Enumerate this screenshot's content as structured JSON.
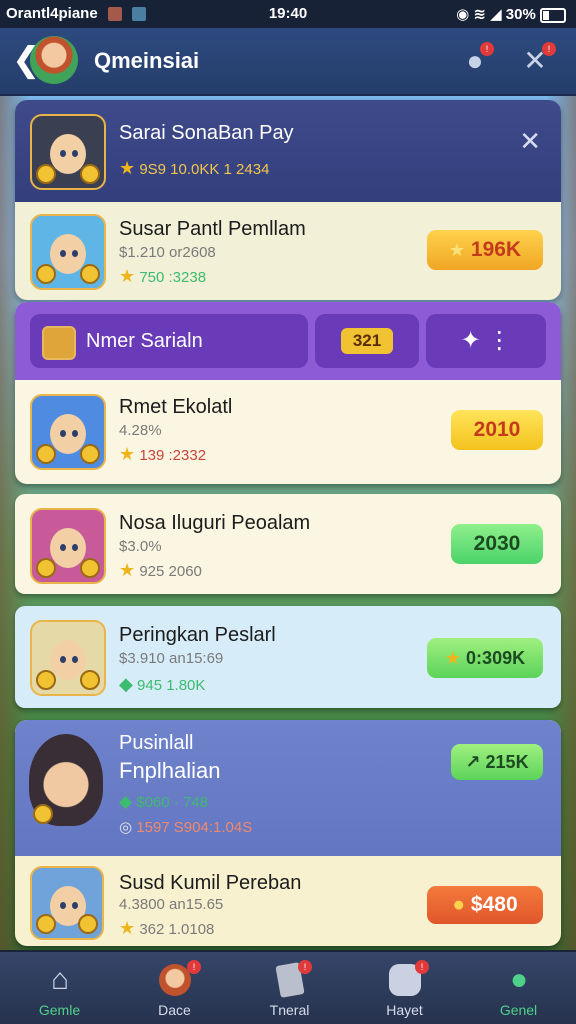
{
  "status_bar": {
    "left_text": "Orantl4piane",
    "time": "19:40",
    "battery": "30%"
  },
  "header": {
    "title": "Qmeinsiai"
  },
  "top_card": {
    "title": "Sarai SonaBan Pay",
    "stats": "9S9  10.0KK 1 2434",
    "close_label": "✕"
  },
  "row1": {
    "name": "Susar Pantl Pemllam",
    "sub": "$1.210   or2608",
    "stat": "750  :3238",
    "value": "196K"
  },
  "filter": {
    "label": "Nmer Sarialn",
    "chip": "321"
  },
  "rows": [
    {
      "name": "Rmet Ekolatl",
      "sub": "4.28%",
      "stat": "139  :2332",
      "value": "2010"
    },
    {
      "name": "Nosa Iluguri Peoalam",
      "sub": "$3.0%",
      "stat": "925   2060",
      "value": "2030"
    },
    {
      "name": "Peringkan Peslarl",
      "sub": "$3.910   an15:69",
      "stat": "945   1.80K",
      "value": "0:309K"
    }
  ],
  "featured": {
    "name_line1": "Pusinlall",
    "name_line2": "Fnplhalian",
    "stat1": "$060 · 748",
    "stat2": "1597  S904:1.04S",
    "value": "215K"
  },
  "last_row": {
    "name": "Susd Kumil Pereban",
    "sub": "4.3800   an15.65",
    "stat": "362   1.0108",
    "value": "$480"
  },
  "nav": [
    {
      "label": "Gemle"
    },
    {
      "label": "Dace"
    },
    {
      "label": "Tneral"
    },
    {
      "label": "Hayet"
    },
    {
      "label": "Genel"
    }
  ],
  "colors": {
    "accent_green": "#3dbb6e",
    "header_bg": "#2e4a7e",
    "filter_purple": "#8e5bd6",
    "badge": "#e13a3a"
  }
}
